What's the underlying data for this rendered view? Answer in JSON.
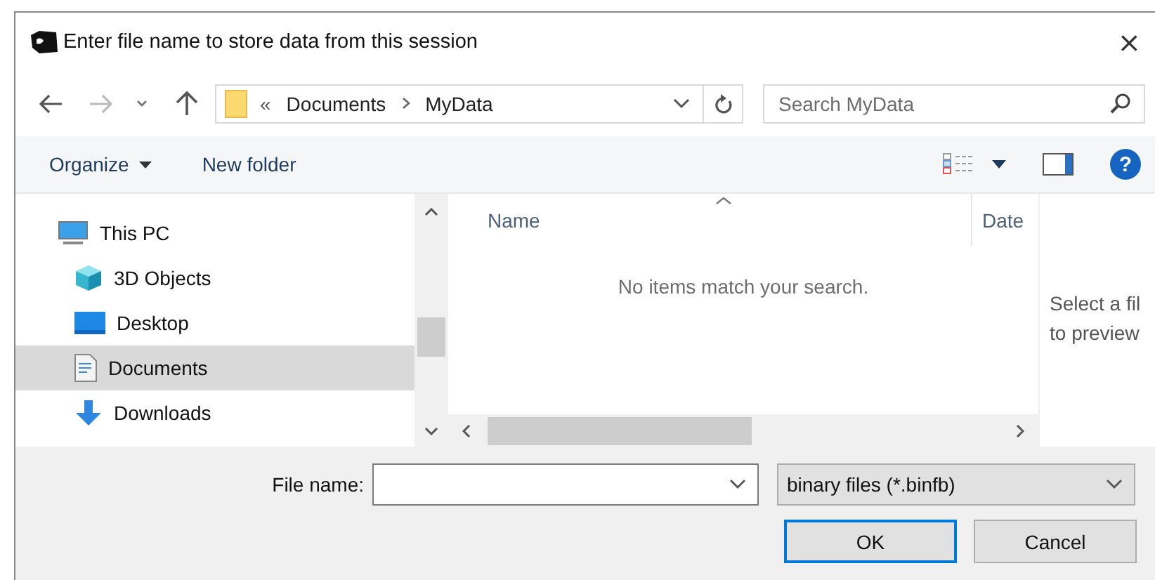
{
  "window": {
    "title": "Enter file name to store data from this session",
    "close": "×"
  },
  "address": {
    "overflow": "«",
    "path": [
      "Documents",
      "MyData"
    ]
  },
  "search": {
    "placeholder": "Search MyData"
  },
  "toolbar": {
    "organize": "Organize",
    "new_folder": "New folder",
    "help": "?"
  },
  "sidebar": {
    "items": [
      {
        "label": "This PC",
        "kind": "pc",
        "selected": false,
        "children": [
          {
            "label": "3D Objects",
            "kind": "cube",
            "selected": false
          },
          {
            "label": "Desktop",
            "kind": "desktop",
            "selected": false
          },
          {
            "label": "Documents",
            "kind": "doc",
            "selected": true
          },
          {
            "label": "Downloads",
            "kind": "download",
            "selected": false
          }
        ]
      }
    ]
  },
  "file_list": {
    "columns": [
      "Name",
      "Date"
    ],
    "empty_message": "No items match your search."
  },
  "preview": {
    "lines": [
      "Select a fil",
      "to preview"
    ]
  },
  "file_name": {
    "label": "File name:"
  },
  "file_type": {
    "value": "binary files (*.binfb)"
  },
  "buttons": [
    {
      "label": "OK",
      "default": true
    },
    {
      "label": "Cancel",
      "default": false
    }
  ]
}
